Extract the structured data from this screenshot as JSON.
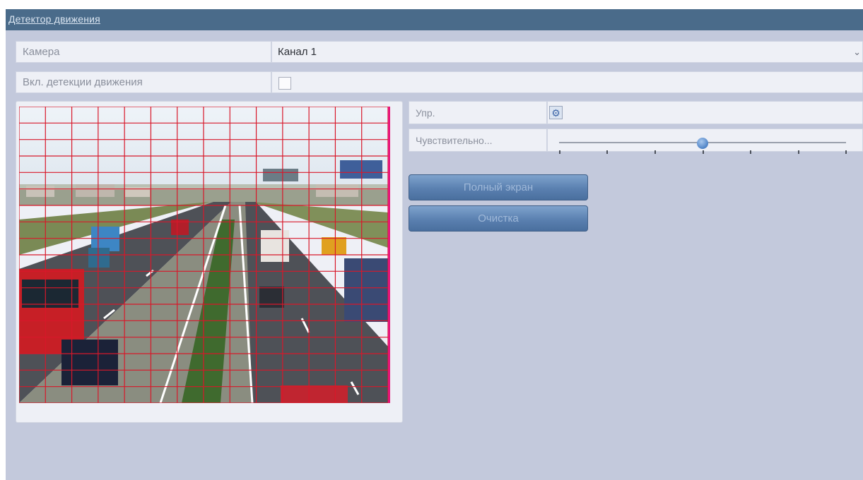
{
  "header": {
    "title": "Детектор движения"
  },
  "camera": {
    "label": "Камера",
    "value": "Канал 1",
    "chevron_icon": "chevron-down"
  },
  "motion_detection": {
    "label": "Вкл. детекции движения",
    "checked": false
  },
  "controls": {
    "manage_label": "Упр.",
    "settings_icon": "gear",
    "sensitivity_label": "Чувствительно...",
    "sensitivity_level_percent": 50
  },
  "buttons": {
    "fullscreen": "Полный экран",
    "clear": "Очистка"
  },
  "colors": {
    "header": "#4a6b8a",
    "panel": "#c3c9dc",
    "grid": "#d8182a",
    "border_accent": "#e8157a",
    "button": "#5a80b0"
  }
}
